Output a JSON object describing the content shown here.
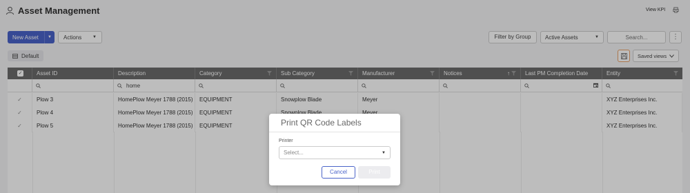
{
  "header": {
    "title": "Asset Management",
    "view_kpi": "View KPI"
  },
  "toolbar": {
    "new_asset": "New Asset",
    "actions": "Actions",
    "filter_by_group": "Filter by Group",
    "active_assets": "Active Assets",
    "search_placeholder": "Search..."
  },
  "views": {
    "default_label": "Default",
    "saved_views": "Saved views"
  },
  "grid": {
    "columns": [
      "Asset ID",
      "Description",
      "Category",
      "Sub Category",
      "Manufacturer",
      "Notices",
      "Last PM Completion Date",
      "Entity"
    ],
    "description_filter": "home",
    "rows": [
      {
        "asset_id": "Plow 3",
        "description": "HomePlow Meyer 1788 (2015)",
        "category": "EQUIPMENT",
        "sub_category": "Snowplow Blade",
        "manufacturer": "Meyer",
        "entity": "XYZ Enterprises Inc."
      },
      {
        "asset_id": "Plow 4",
        "description": "HomePlow Meyer 1788 (2015)",
        "category": "EQUIPMENT",
        "sub_category": "Snowplow Blade",
        "manufacturer": "Meyer",
        "entity": "XYZ Enterprises Inc."
      },
      {
        "asset_id": "Plow 5",
        "description": "HomePlow Meyer 1788 (2015)",
        "category": "EQUIPMENT",
        "sub_category": "",
        "manufacturer": "",
        "entity": "XYZ Enterprises Inc."
      }
    ]
  },
  "modal": {
    "title": "Print QR Code Labels",
    "printer_label": "Printer",
    "printer_placeholder": "Select...",
    "cancel": "Cancel",
    "print": "Print"
  },
  "colors": {
    "primary": "#4a63c9",
    "header_bg": "#6b6b6b",
    "accent_orange": "#e8a067"
  }
}
